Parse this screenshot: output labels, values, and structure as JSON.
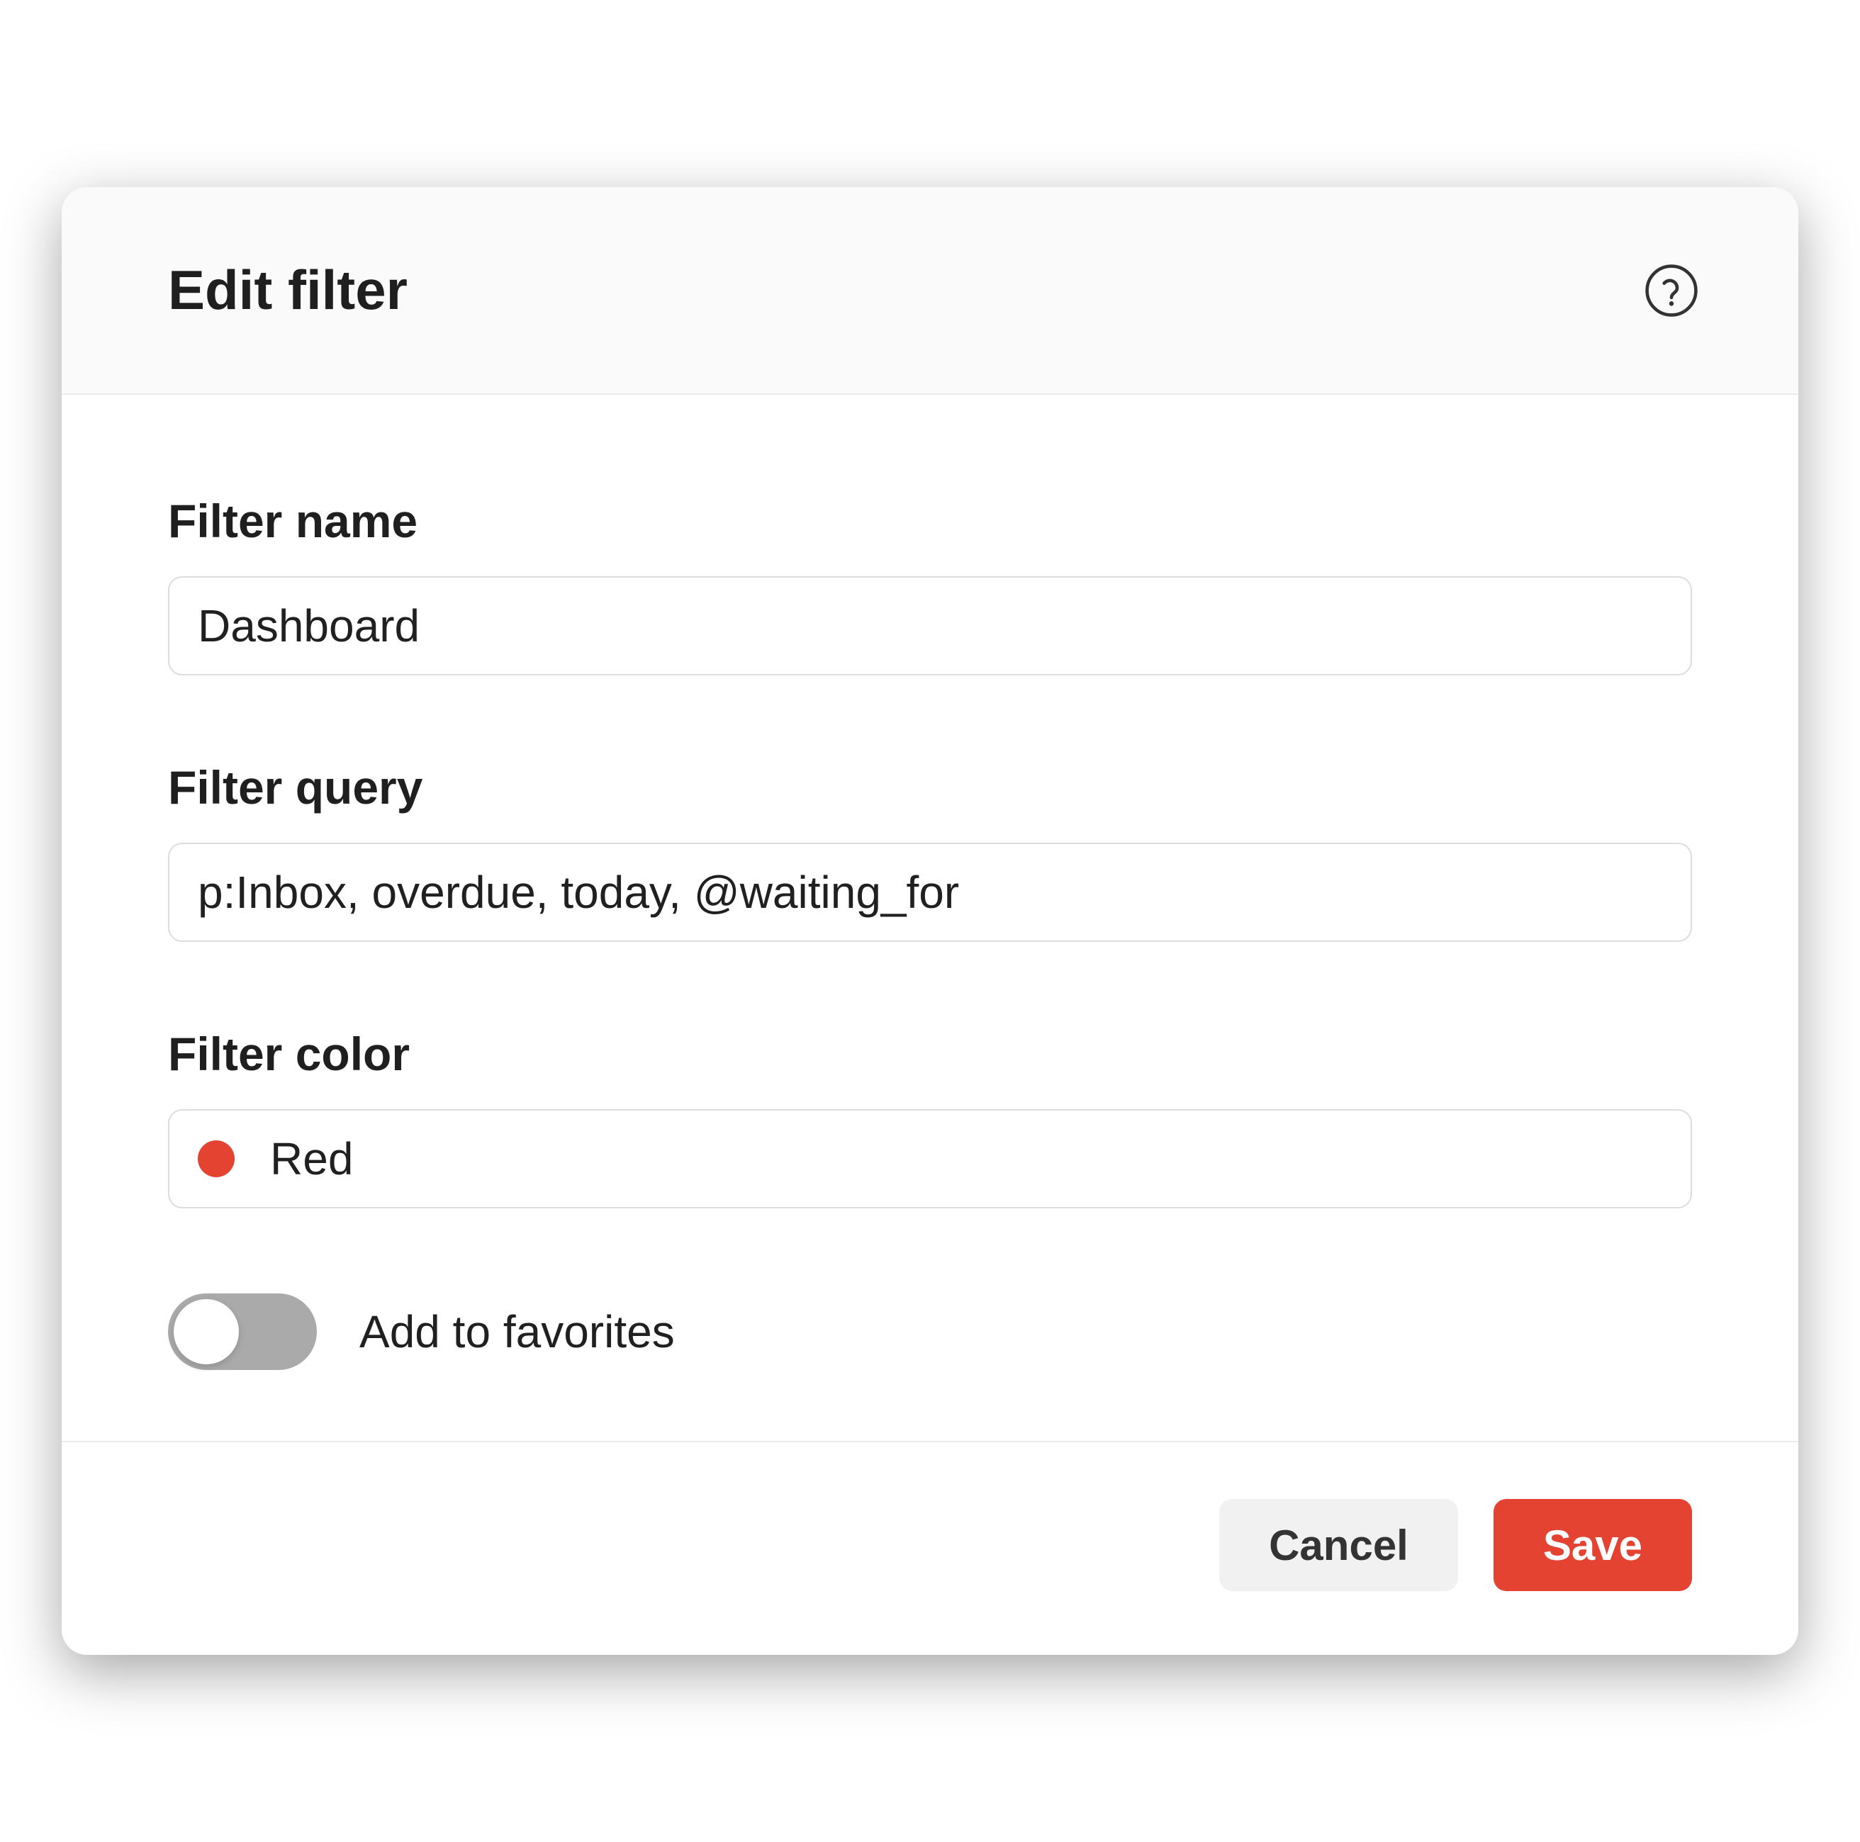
{
  "header": {
    "title": "Edit filter",
    "help_icon": "question-mark-circle-icon"
  },
  "form": {
    "filter_name": {
      "label": "Filter name",
      "value": "Dashboard",
      "placeholder": ""
    },
    "filter_query": {
      "label": "Filter query",
      "value": "p:Inbox, overdue, today, @waiting_for",
      "placeholder": ""
    },
    "filter_color": {
      "label": "Filter color",
      "selected_name": "Red",
      "selected_hex": "#e44332"
    },
    "favorites": {
      "label": "Add to favorites",
      "on": false
    }
  },
  "footer": {
    "cancel_label": "Cancel",
    "save_label": "Save"
  },
  "colors": {
    "accent": "#e44332"
  }
}
